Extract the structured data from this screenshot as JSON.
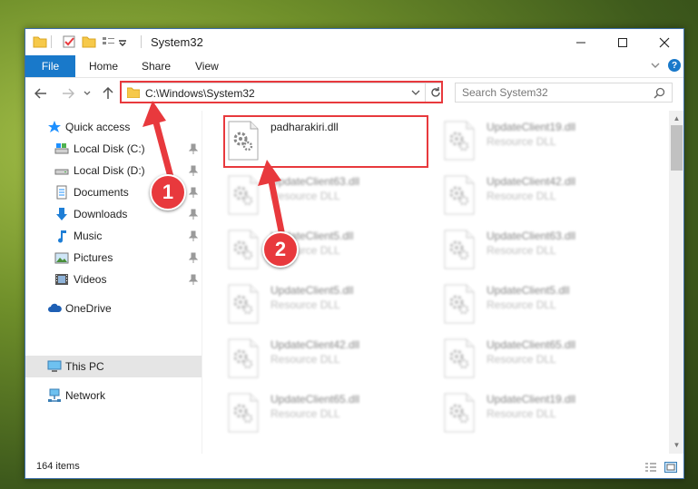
{
  "window": {
    "title": "System32"
  },
  "ribbon": {
    "tabs": [
      "File",
      "Home",
      "Share",
      "View"
    ],
    "help_label": "?"
  },
  "address": {
    "path": "C:\\Windows\\System32"
  },
  "search": {
    "placeholder": "Search System32"
  },
  "sidebar": {
    "items": [
      {
        "label": "Quick access",
        "icon": "star-icon"
      },
      {
        "label": "Local Disk (C:)",
        "icon": "drive-icon"
      },
      {
        "label": "Local Disk (D:)",
        "icon": "drive-icon"
      },
      {
        "label": "Documents",
        "icon": "documents-icon"
      },
      {
        "label": "Downloads",
        "icon": "download-icon"
      },
      {
        "label": "Music",
        "icon": "music-icon"
      },
      {
        "label": "Pictures",
        "icon": "pictures-icon"
      },
      {
        "label": "Videos",
        "icon": "videos-icon"
      },
      {
        "label": "OneDrive",
        "icon": "cloud-icon"
      },
      {
        "label": "This PC",
        "icon": "computer-icon"
      },
      {
        "label": "Network",
        "icon": "network-icon"
      }
    ]
  },
  "files": [
    {
      "name": "padharakiri.dll",
      "type": ""
    },
    {
      "name": "UpdateClient19.dll",
      "type": "Resource DLL"
    },
    {
      "name": "UpdateClient63.dll",
      "type": "Resource DLL"
    },
    {
      "name": "UpdateClient42.dll",
      "type": "Resource DLL"
    },
    {
      "name": "UpdateClient5.dll",
      "type": "Resource DLL"
    },
    {
      "name": "UpdateClient63.dll",
      "type": "Resource DLL"
    },
    {
      "name": "UpdateClient5.dll",
      "type": "Resource DLL"
    },
    {
      "name": "UpdateClient5.dll",
      "type": "Resource DLL"
    },
    {
      "name": "UpdateClient42.dll",
      "type": "Resource DLL"
    },
    {
      "name": "UpdateClient65.dll",
      "type": "Resource DLL"
    },
    {
      "name": "UpdateClient65.dll",
      "type": "Resource DLL"
    },
    {
      "name": "UpdateClient19.dll",
      "type": "Resource DLL"
    }
  ],
  "status": {
    "item_count": "164 items"
  },
  "callouts": {
    "one": "1",
    "two": "2"
  },
  "colors": {
    "accent": "#1979ca",
    "highlight": "#e8393d",
    "selected": "#cce8ff"
  }
}
